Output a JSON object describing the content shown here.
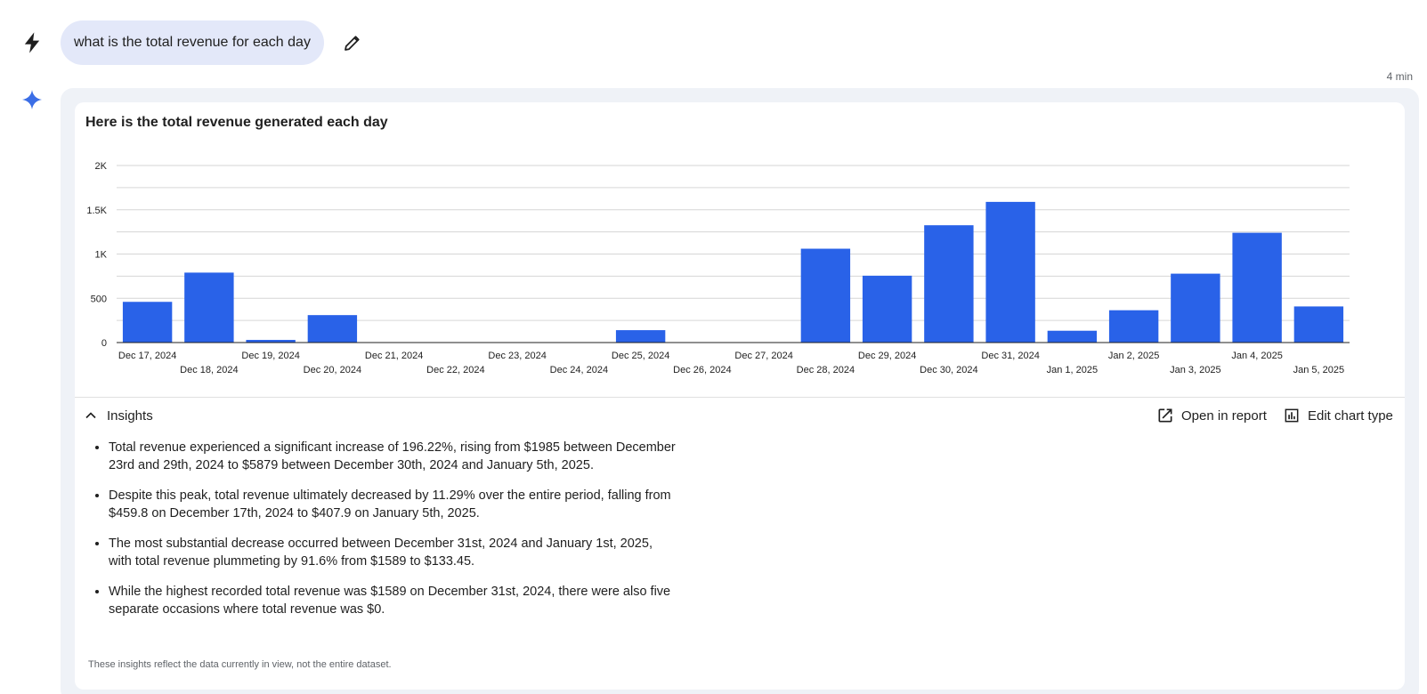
{
  "query": {
    "text": "what is the total revenue for each day",
    "user_icon": "lightning-icon",
    "edit_icon": "pencil-icon"
  },
  "timestamp": "4 min",
  "assistant_icon": "sparkle-icon",
  "response": {
    "chart_data": {
      "type": "bar",
      "title": "Here is the total revenue generated each day",
      "categories": [
        "Dec 17, 2024",
        "Dec 18, 2024",
        "Dec 19, 2024",
        "Dec 20, 2024",
        "Dec 21, 2024",
        "Dec 22, 2024",
        "Dec 23, 2024",
        "Dec 24, 2024",
        "Dec 25, 2024",
        "Dec 26, 2024",
        "Dec 27, 2024",
        "Dec 28, 2024",
        "Dec 29, 2024",
        "Dec 30, 2024",
        "Dec 31, 2024",
        "Jan 1, 2025",
        "Jan 2, 2025",
        "Jan 3, 2025",
        "Jan 4, 2025",
        "Jan 5, 2025"
      ],
      "values": [
        459.8,
        790,
        30,
        310,
        0,
        0,
        0,
        0,
        140,
        0,
        0,
        1060,
        755,
        1325,
        1589,
        133.45,
        365,
        778,
        1240,
        407.9
      ],
      "ylim": [
        0,
        2000
      ],
      "yticks": [
        {
          "value": 0,
          "label": "0"
        },
        {
          "value": 500,
          "label": "500"
        },
        {
          "value": 1000,
          "label": "1K"
        },
        {
          "value": 1500,
          "label": "1.5K"
        },
        {
          "value": 2000,
          "label": "2K"
        }
      ],
      "grid": true,
      "color": "#2962e8"
    },
    "insights_label": "Insights",
    "open_report_label": "Open in report",
    "edit_chart_label": "Edit chart type",
    "insights": [
      "Total revenue experienced a significant increase of 196.22%, rising from $1985 between December 23rd and 29th, 2024 to $5879 between December 30th, 2024 and January 5th, 2025.",
      "Despite this peak, total revenue ultimately decreased by 11.29% over the entire period, falling from $459.8 on December 17th, 2024 to $407.9 on January 5th, 2025.",
      "The most substantial decrease occurred between December 31st, 2024 and January 1st, 2025, with total revenue plummeting by 91.6% from $1589 to $133.45.",
      "While the highest recorded total revenue was $1589 on December 31st, 2024, there were also five separate occasions where total revenue was $0."
    ],
    "disclaimer": "These insights reflect the data currently in view, not the entire dataset."
  }
}
